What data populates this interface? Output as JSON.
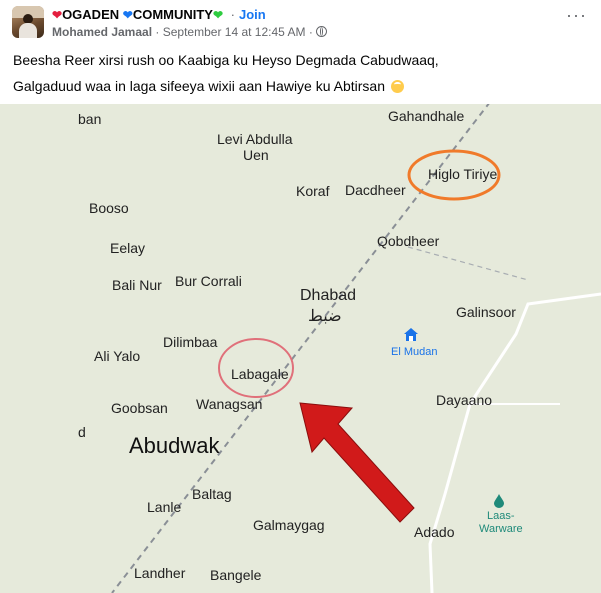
{
  "post": {
    "group_name": "OGADEN",
    "group_name_2": "COMMUNITY",
    "join_label": "Join",
    "author": "Mohamed Jamaal",
    "timestamp": "September 14 at 12:45 AM",
    "more_label": "···",
    "text_line_1": "Beesha Reer xirsi rush oo Kaabiga ku Heyso Degmada Cabudwaaq,",
    "text_line_2": "Galgaduud waa in laga sifeeya wixii aan Hawiye ku Abtirsan",
    "colors": {
      "join": "#1877f2",
      "text": "#050505",
      "meta": "#65676b"
    }
  },
  "map": {
    "labels": {
      "ban": "ban",
      "gahandhale": "Gahandhale",
      "levi_abdulla": "Levi Abdulla",
      "uen": "Uen",
      "higlo_tiriye": "Higlo Tiriye",
      "koraf": "Koraf",
      "dacdheer": "Dacdheer",
      "booso": "Booso",
      "qobdheer": "Qobdheer",
      "eelay": "Eelay",
      "bali_nur": "Bali Nur",
      "bur_corrali": "Bur Corrali",
      "dhabad": "Dhabad",
      "dhabad_arabic": "ضبط",
      "galinsoor": "Galinsoor",
      "el_mudan": "El Mudan",
      "dilimbaa": "Dilimbaa",
      "ali_yalo": "Ali Yalo",
      "labagale": "Labagale",
      "goobsan": "Goobsan",
      "wanagsan": "Wanagsan",
      "dayaano": "Dayaano",
      "d": "d",
      "abudwak": "Abudwak",
      "baltag": "Baltag",
      "lanle": "Lanle",
      "laas_warware_1": "Laas-",
      "laas_warware_2": "Warware",
      "galmaygag": "Galmaygag",
      "adado": "Adado",
      "landher": "Landher",
      "bangele": "Bangele"
    },
    "annotation_colors": {
      "orange_circle": "#f07a2a",
      "red_circle": "#e0707a",
      "arrow": "#d11a1a"
    },
    "icons": [
      "blue-house-icon",
      "teal-water-drop-icon"
    ]
  }
}
